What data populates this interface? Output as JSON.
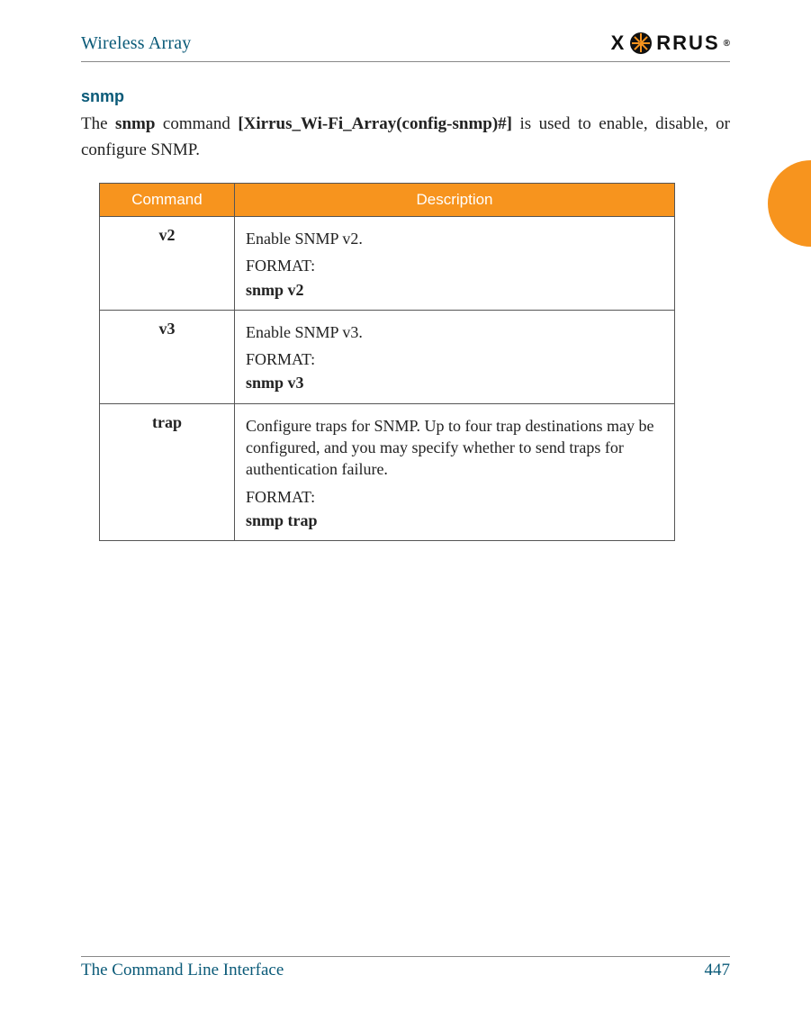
{
  "header": {
    "doc_title": "Wireless Array",
    "logo_text_left": "X",
    "logo_text_right": "RRUS",
    "logo_tm": "®"
  },
  "section": {
    "title": "snmp",
    "intro_pre": "The ",
    "intro_cmd": "snmp",
    "intro_mid": " command ",
    "intro_bracket_open": "[",
    "intro_prompt": "Xirrus_Wi-Fi_Array(config-snmp)#",
    "intro_bracket_close": "]",
    "intro_post": " is used to enable, disable, or configure SNMP."
  },
  "table": {
    "headers": {
      "command": "Command",
      "description": "Description"
    },
    "rows": [
      {
        "name": "v2",
        "desc_line": "Enable SNMP v2.",
        "format_label": "FORMAT:",
        "format_cmd": "snmp v2"
      },
      {
        "name": "v3",
        "desc_line": "Enable SNMP v3.",
        "format_label": "FORMAT:",
        "format_cmd": "snmp v3"
      },
      {
        "name": "trap",
        "desc_line": "Configure traps for SNMP. Up to four trap destinations may be configured, and you may specify whether to send traps for authentication failure.",
        "format_label": "FORMAT:",
        "format_cmd": "snmp trap"
      }
    ]
  },
  "footer": {
    "left": "The Command Line Interface",
    "page": "447"
  }
}
